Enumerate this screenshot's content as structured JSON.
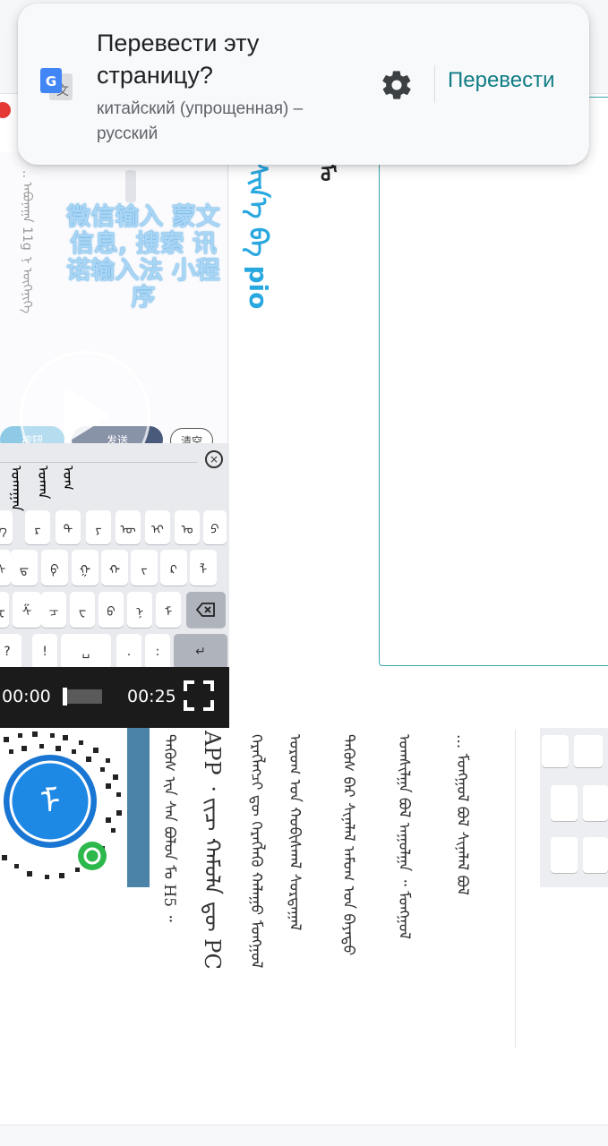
{
  "translate_popup": {
    "title": "Перевести эту страницу?",
    "languages": "китайский (упрощенная) – русский",
    "translate_label": "Перевести",
    "icons": [
      "google-translate-icon",
      "gear-icon"
    ]
  },
  "promo": {
    "text": "微信输入 蒙文信息, 搜索 讯诺输入法 小程序",
    "faint_vertical": ".. ᠠᠪᠤᠨᠠᠭᠠ 11g ᠨ ᠦᠭᠡᠨᠢᠬᠡ"
  },
  "chat": {
    "left_pill": "按钮",
    "send_pill": "发送",
    "clear_pill": "清空"
  },
  "keyboard": {
    "suggestions": [
      "ᠤᠬᠠᠭᠠᠨ",
      "ᠤᠬᠠᠨ",
      "ᠤᠬ"
    ],
    "row1_hints": [
      "e",
      "r",
      "t",
      "y",
      "u",
      "i",
      "o",
      "p"
    ],
    "row1_keys": [
      "ᠡ",
      "ᠷ",
      "ᠲ",
      "ᠶ",
      "ᠦ",
      "ᠢ",
      "ᠣ",
      "ᠫ"
    ],
    "row2_hints": [
      "s",
      "d",
      "f",
      "g",
      "h",
      "j",
      "k",
      ""
    ],
    "row2_keys": [
      "ᠰ",
      "ᠳ",
      "ᠹ",
      "ᠭ",
      "ᠬ",
      "ᠵ",
      "ᠺ",
      "ᠯ"
    ],
    "row3_hints": [
      "z",
      "x",
      "c",
      "v",
      "b",
      "n",
      "m"
    ],
    "row3_keys": [
      "ᠽ",
      "ᠱ",
      "ᠴ",
      "ᠸ",
      "ᠪ",
      "ᠨ",
      "ᠮ"
    ],
    "row4_keys": [
      "?",
      "!",
      "␣",
      ".",
      ":",
      "↵"
    ],
    "delete_icon": "backspace-icon"
  },
  "video": {
    "current_time": "00:00",
    "duration": "00:25",
    "progress": 0.0
  },
  "content": {
    "blue_heading": "ᠰᠢᠨ᠎ᠡ ᠪᠠ pio",
    "black_glyph": "ᠮᠣ",
    "columns": [
      "ᠲᠡᠭᠦᠰ ᠢᠨ ᠰᠠᠨ ᠪᠣᠯᠤᠨ ᠮᠣ H5 ᠃",
      "APP ᠂ ᠵᠢᠴ ᠬᠠᠮᠦᠯᠡ ᠳᠦ PC",
      "ᠬᠡᠷᠡᠭᠯᠡᠭᠴᠢ ᠳᠦ ᠬᠡᠷᠡᠭᠯᠡᠬᠦ ᠬᠠᠯᠠᠭᠤ ᠮᠣᠩᠭᠤᠯ",
      "ᠤᠷᠤᠭ ᠤᠨ ᠬᠤᠪᠢᠰᠬᠠᠯ ᠰᠤᠷᠲᠠᠭᠠᠯ",
      "ᠲᠡᠭᠦᠰ ᠪᠠᠷ ᠰᠢᠨᠡᠯᠡᠯ ᠠᠮᠤᠭ ᠤᠨ ᠪᠡᠶᠡᠳᠦ",
      "ᠤᠭᠰᠢᠯᠭᠠ ᠪᠣᠯ ᠠᠭᠤᠯᠭᠠ ᠃ ᠮᠣᠩᠭᠤᠯ",
      "... ᠮᠣᠩᠭᠤᠯ ᠪᠣᠯ ᠰᠢᠨᠡᠯᠡᠯ ᠪᠣᠯ"
    ]
  }
}
